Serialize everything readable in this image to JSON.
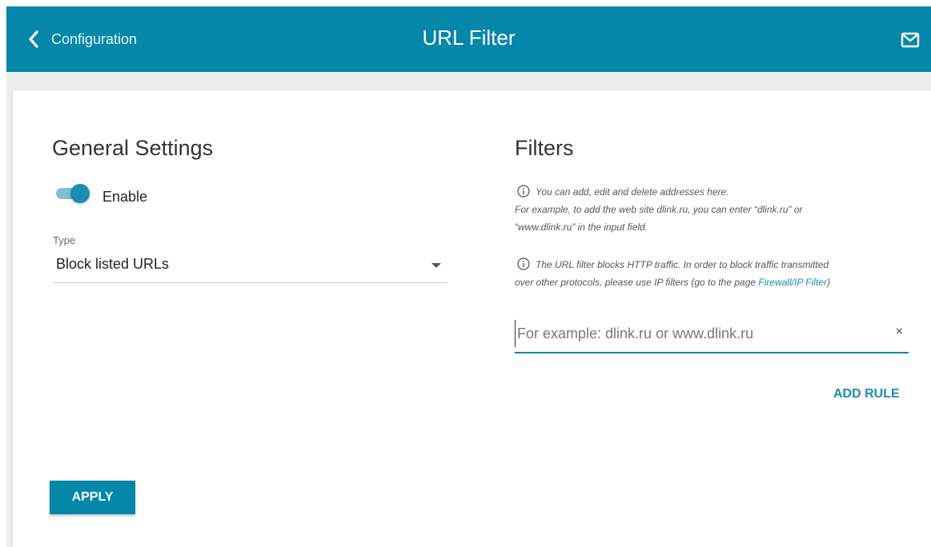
{
  "header": {
    "back_label": "Configuration",
    "title": "URL Filter",
    "back_icon": "chevron-left-icon",
    "mail_icon": "mail-icon",
    "background": "#0587aa"
  },
  "general": {
    "title": "General Settings",
    "enable_label": "Enable",
    "enable_on": true,
    "type_label": "Type",
    "type_value": "Block listed URLs",
    "apply_label": "APPLY"
  },
  "filters": {
    "title": "Filters",
    "info1_line1": "You can add, edit and delete addresses here.",
    "info1_line2": "For example, to add the web site dlink.ru, you can enter “dlink.ru” or",
    "info1_line3": "“www.dlink.ru” in the input field.",
    "info2_line1": "The URL filter blocks HTTP traffic. In order to block traffic transmitted",
    "info2_line2": "over other protocols, please use IP filters (go to the page ",
    "info2_link": "Firewall/IP Filter",
    "info2_end": ")",
    "input_placeholder": "For example: dlink.ru or www.dlink.ru",
    "input_value": "",
    "clear_symbol": "×",
    "add_rule_label": "ADD RULE"
  }
}
